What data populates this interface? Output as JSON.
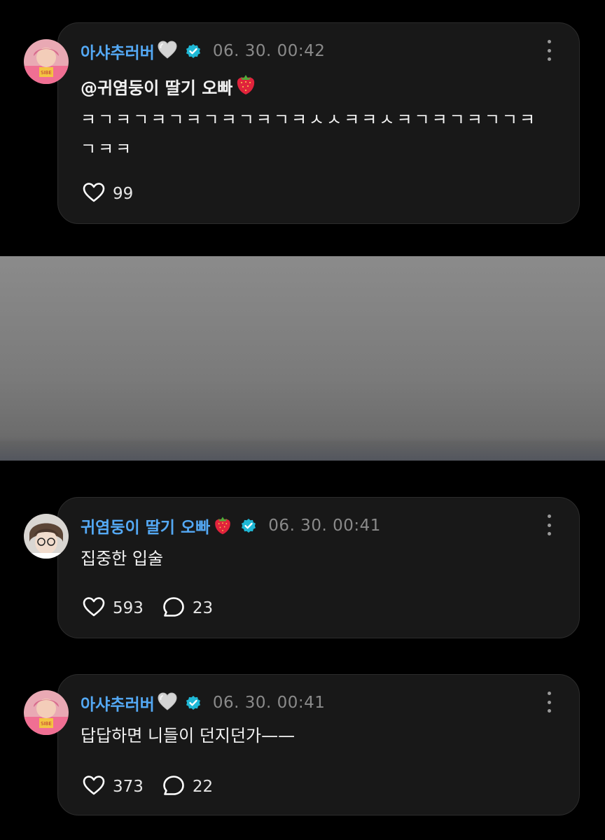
{
  "comments": [
    {
      "username": "아샤추러버",
      "username_emoji": "grey-heart",
      "timestamp": "06. 30. 00:42",
      "mention": "@귀염둥이 딸기 오빠",
      "mention_emoji": "strawberry",
      "text": "ㅋㄱㅋㄱㅋㄱㅋㄱㅋㄱㅋㄱㅋㅅㅅㅋㅋㅅㅋㄱㅋㄱㅋㄱㄱㅋ ㄱㅋㅋ",
      "likes": "99"
    },
    {
      "username": "귀염둥이 딸기 오빠",
      "username_emoji": "strawberry",
      "timestamp": "06. 30. 00:41",
      "text": "집중한 입술",
      "likes": "593",
      "replies": "23"
    },
    {
      "username": "아샤추러버",
      "username_emoji": "grey-heart",
      "timestamp": "06. 30. 00:41",
      "text": "답답하면 니들이 던지던가——",
      "likes": "373",
      "replies": "22"
    }
  ],
  "colors": {
    "background": "#000000",
    "card": "#181818",
    "username": "#54a9f5",
    "verified": "#1fb8d6",
    "timestamp": "#8a8a8a"
  },
  "icons": [
    "more-icon",
    "verified-icon",
    "heart-icon",
    "comment-icon",
    "grey-heart-emoji",
    "strawberry-emoji"
  ]
}
